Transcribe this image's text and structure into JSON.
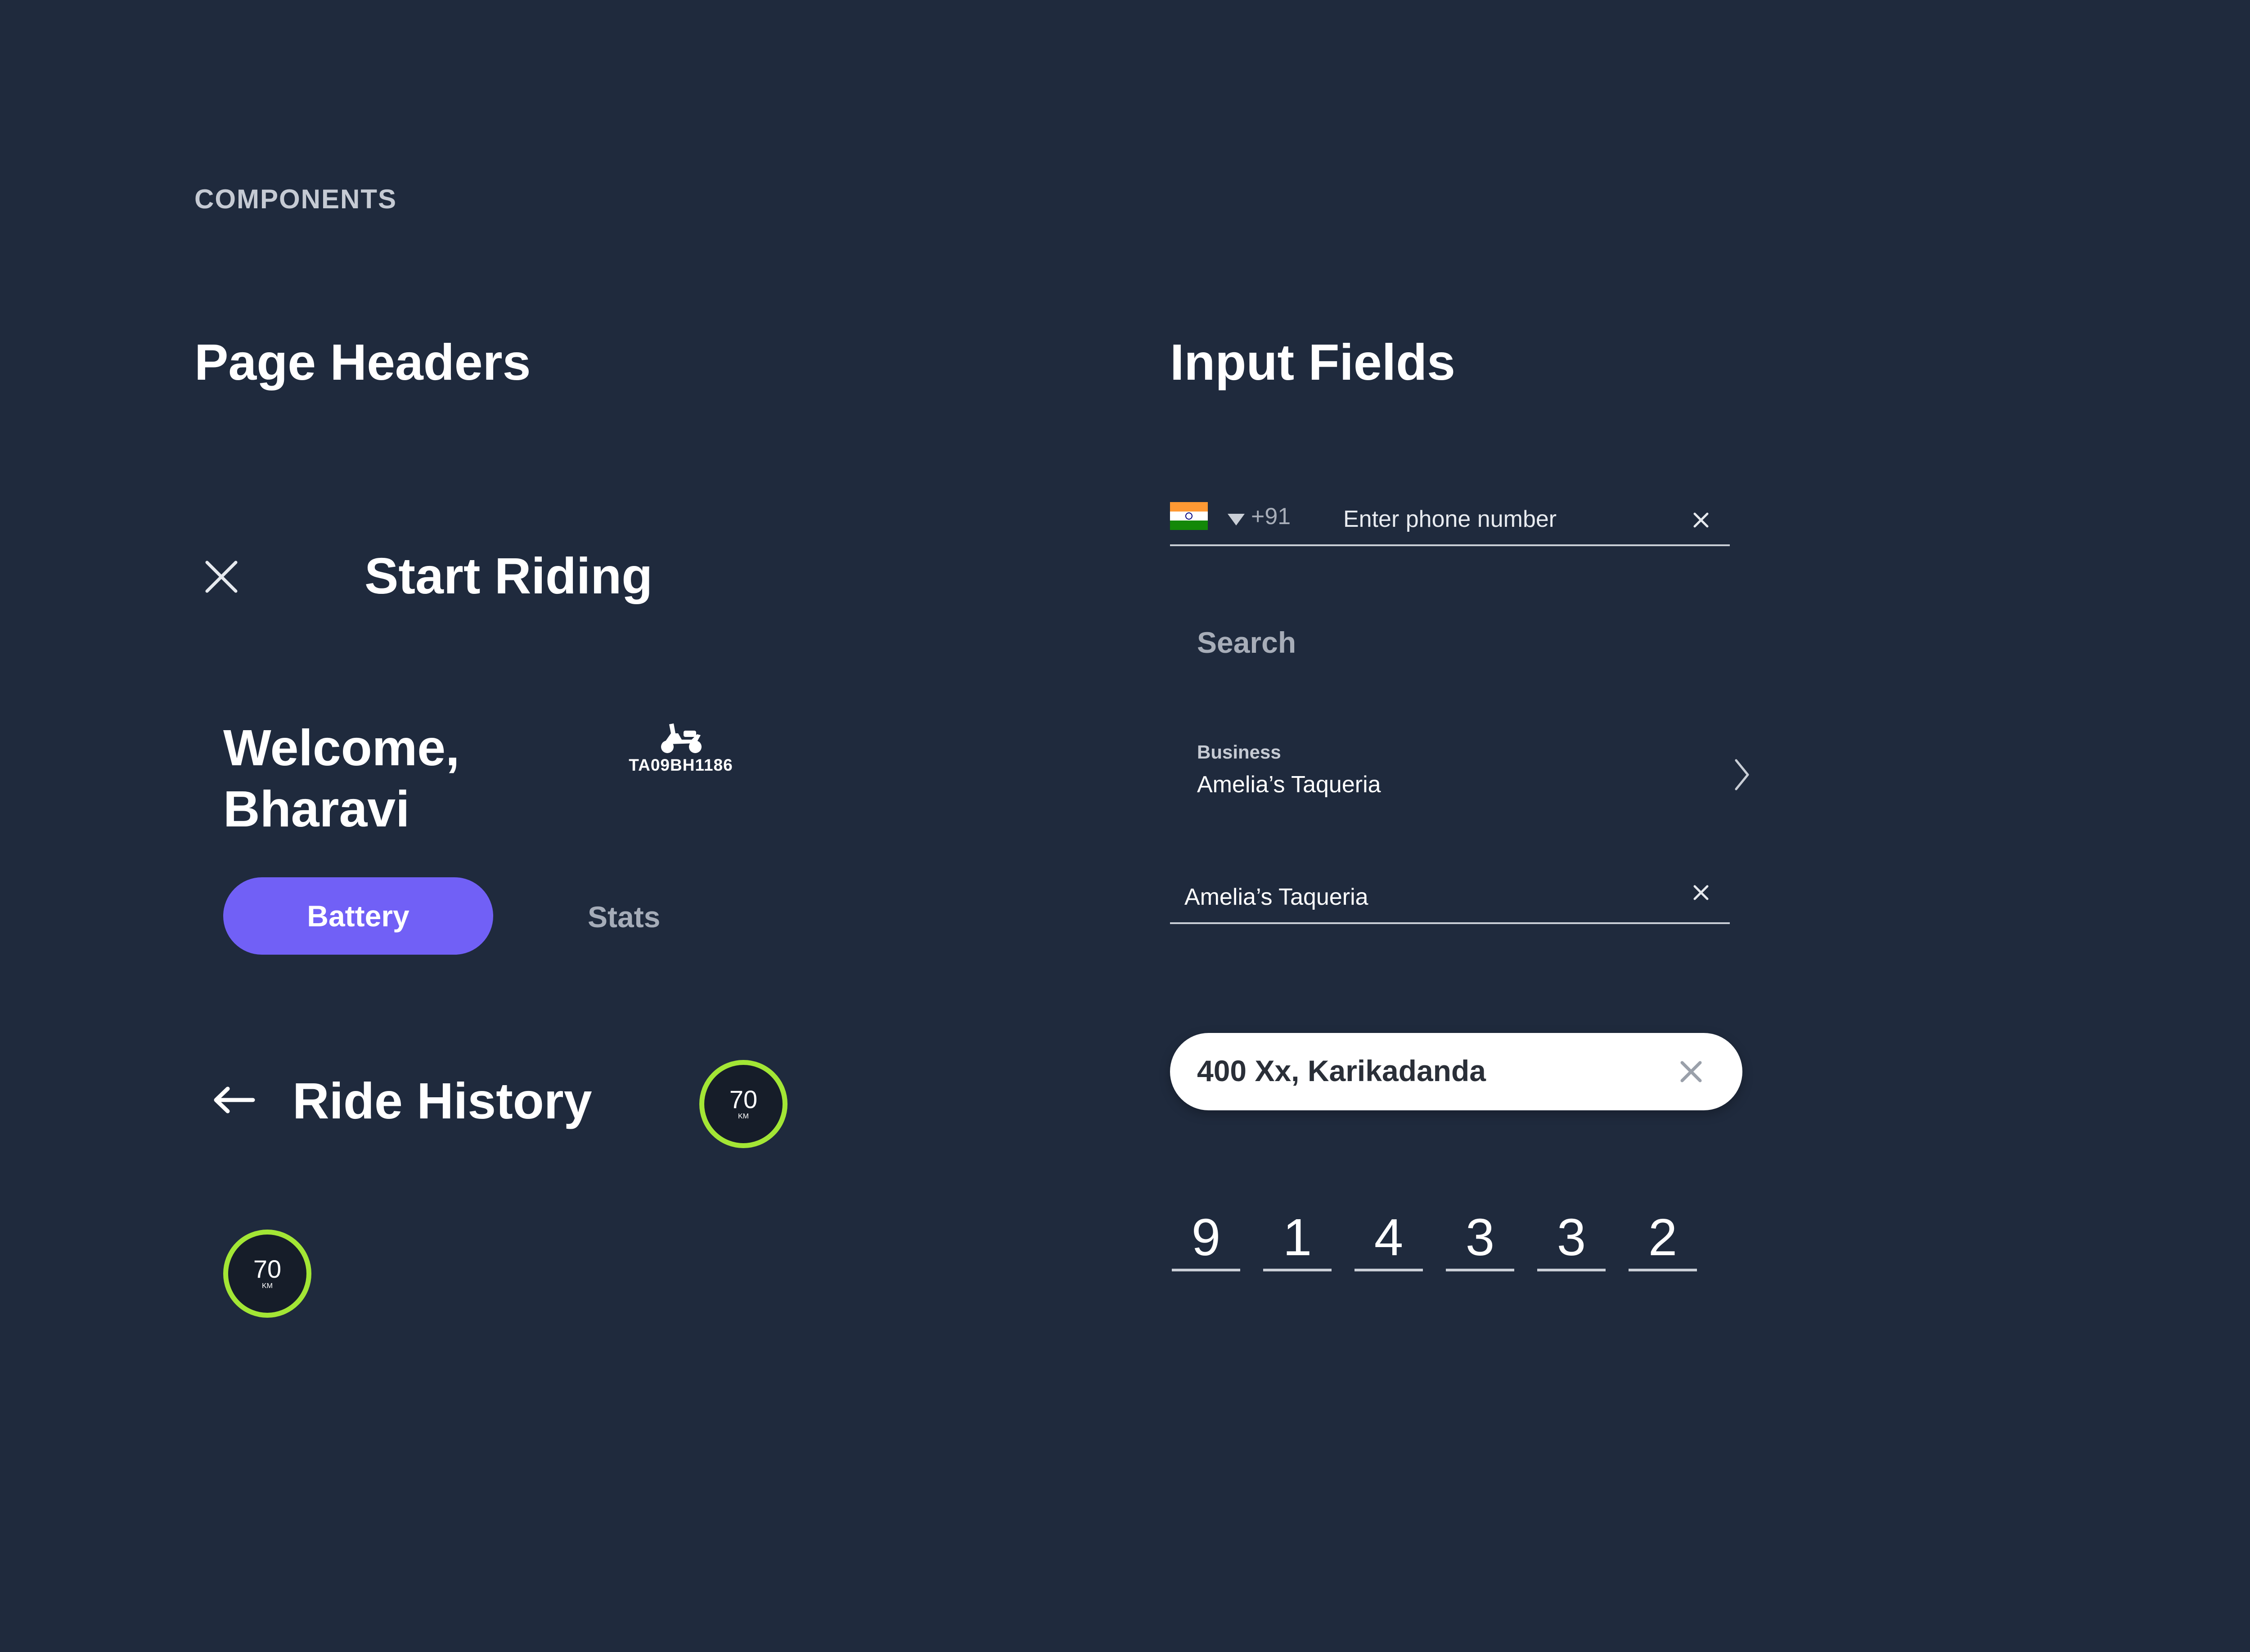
{
  "eyebrow": "COMPONENTS",
  "sections": {
    "page_headers": "Page Headers",
    "input_fields": "Input Fields"
  },
  "headers": {
    "start_riding": "Start Riding",
    "welcome_line1": "Welcome,",
    "welcome_line2": "Bharavi",
    "vehicle_plate": "TA09BH1186",
    "tabs": {
      "active": "Battery",
      "inactive": "Stats"
    },
    "ride_history": "Ride History",
    "gauge": {
      "value": "70",
      "unit": "KM"
    }
  },
  "inputs": {
    "phone": {
      "country_code": "+91",
      "placeholder": "Enter phone number"
    },
    "search": {
      "placeholder": "Search"
    },
    "business": {
      "label": "Business",
      "value": "Amelia’s Taqueria"
    },
    "text_field": {
      "value": "Amelia’s Taqueria"
    },
    "location": {
      "value": "400 Xx, Karikadanda"
    },
    "otp": [
      "9",
      "1",
      "4",
      "3",
      "3",
      "2"
    ]
  },
  "colors": {
    "background": "#1f2a3d",
    "accent": "#7160f6",
    "gauge_ring": "#a3e635"
  }
}
